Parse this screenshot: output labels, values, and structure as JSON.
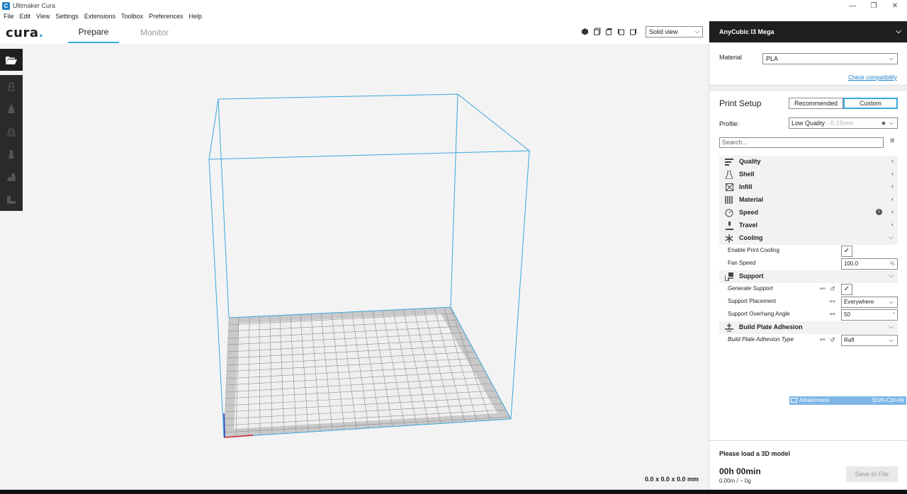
{
  "window": {
    "title": "Ultimaker Cura",
    "min_icon": "minimize-icon",
    "max_icon": "restore-icon",
    "close_icon": "close-icon"
  },
  "menu": [
    "File",
    "Edit",
    "View",
    "Settings",
    "Extensions",
    "Toolbox",
    "Preferences",
    "Help"
  ],
  "header": {
    "logo": "cura",
    "logo_dot": ".",
    "tabs": [
      {
        "label": "Prepare",
        "active": true
      },
      {
        "label": "Monitor",
        "active": false
      }
    ],
    "view_mode": "Solid view"
  },
  "viewport": {
    "dimensions": "0.0 x 0.0 x 0.0 mm",
    "build_volume_color": "#3aa7dc"
  },
  "panel": {
    "printer": "AnyCubic I3 Mega",
    "material_label": "Material",
    "material_value": "PLA",
    "compat_link": "Check compatibility",
    "print_setup": "Print Setup",
    "mode_recommended": "Recommended",
    "mode_custom": "Custom",
    "profile_label": "Profile:",
    "profile_value": "Low Quality",
    "profile_suffix": " - 0.15mm",
    "search_placeholder": "Search...",
    "categories": [
      {
        "label": "Quality",
        "icon": "quality-icon"
      },
      {
        "label": "Shell",
        "icon": "shell-icon"
      },
      {
        "label": "Infill",
        "icon": "infill-icon"
      },
      {
        "label": "Material",
        "icon": "material-icon"
      },
      {
        "label": "Speed",
        "icon": "speed-icon"
      },
      {
        "label": "Travel",
        "icon": "travel-icon"
      },
      {
        "label": "Cooling",
        "icon": "cooling-icon"
      },
      {
        "label": "Support",
        "icon": "support-icon"
      },
      {
        "label": "Build Plate Adhesion",
        "icon": "adhesion-icon"
      }
    ],
    "settings": {
      "enable_print_cooling": "Enable Print Cooling",
      "fan_speed": "Fan Speed",
      "fan_speed_value": "100.0",
      "fan_speed_unit": "%",
      "generate_support": "Generate Support",
      "support_placement": "Support Placement",
      "support_placement_value": "Everywhere",
      "support_overhang": "Support Overhang Angle",
      "support_overhang_value": "50",
      "support_overhang_unit": "°",
      "adhesion_type": "Build Plate Adhesion Type",
      "adhesion_type_value": "Raft"
    },
    "tooltip": {
      "label": "Ablak/menü",
      "shortcut": "Shift+Ctrl+W"
    },
    "load_msg": "Please load a 3D model",
    "time": "00h 00min",
    "usage": "0.00m / ~ 0g",
    "save": "Save to File"
  }
}
